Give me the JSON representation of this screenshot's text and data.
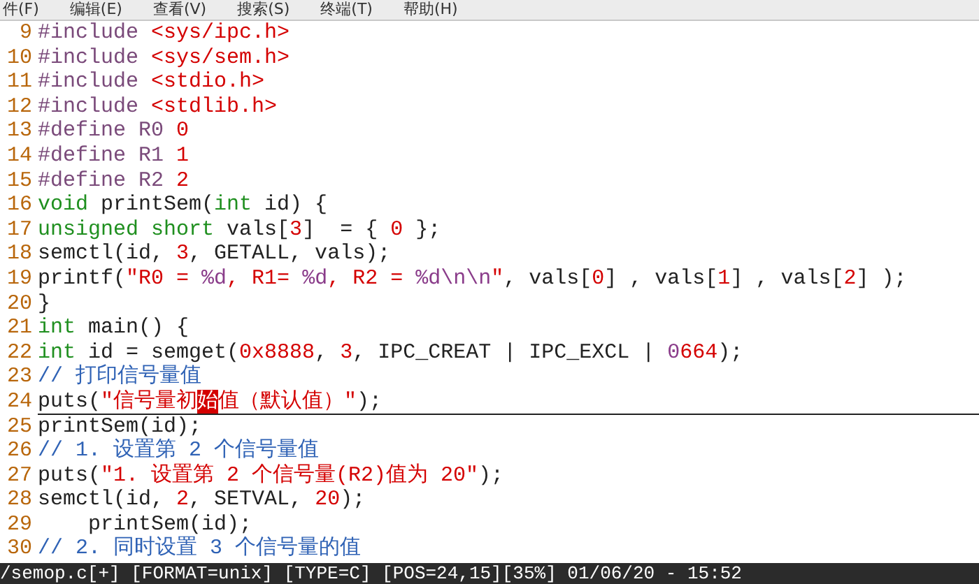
{
  "menu_bar": [
    "件(F)",
    "编辑(E)",
    "查看(V)",
    "搜索(S)",
    "终端(T)",
    "帮助(H)"
  ],
  "lines": [
    {
      "number": "9",
      "current": false,
      "segments": [
        {
          "text": "#include ",
          "kind": "preproc"
        },
        {
          "text": "<sys/ipc.h>",
          "kind": "string"
        }
      ]
    },
    {
      "number": "10",
      "current": false,
      "segments": [
        {
          "text": "#include ",
          "kind": "preproc"
        },
        {
          "text": "<sys/sem.h>",
          "kind": "string"
        }
      ]
    },
    {
      "number": "11",
      "current": false,
      "segments": [
        {
          "text": "#include ",
          "kind": "preproc"
        },
        {
          "text": "<stdio.h>",
          "kind": "string"
        }
      ]
    },
    {
      "number": "12",
      "current": false,
      "segments": [
        {
          "text": "#include ",
          "kind": "preproc"
        },
        {
          "text": "<stdlib.h>",
          "kind": "string"
        }
      ]
    },
    {
      "number": "13",
      "current": false,
      "segments": [
        {
          "text": "#define R0 ",
          "kind": "preproc"
        },
        {
          "text": "0",
          "kind": "number"
        }
      ]
    },
    {
      "number": "14",
      "current": false,
      "segments": [
        {
          "text": "#define R1 ",
          "kind": "preproc"
        },
        {
          "text": "1",
          "kind": "number"
        }
      ]
    },
    {
      "number": "15",
      "current": false,
      "segments": [
        {
          "text": "#define R2 ",
          "kind": "preproc"
        },
        {
          "text": "2",
          "kind": "number"
        }
      ]
    },
    {
      "number": "16",
      "current": false,
      "segments": [
        {
          "text": "void",
          "kind": "type"
        },
        {
          "text": " printSem(",
          "kind": "plain"
        },
        {
          "text": "int",
          "kind": "type"
        },
        {
          "text": " id) {",
          "kind": "plain"
        }
      ]
    },
    {
      "number": "17",
      "current": false,
      "segments": [
        {
          "text": "unsigned short",
          "kind": "type"
        },
        {
          "text": " vals[",
          "kind": "plain"
        },
        {
          "text": "3",
          "kind": "number"
        },
        {
          "text": "]  = { ",
          "kind": "plain"
        },
        {
          "text": "0",
          "kind": "number"
        },
        {
          "text": " };",
          "kind": "plain"
        }
      ]
    },
    {
      "number": "18",
      "current": false,
      "segments": [
        {
          "text": "semctl(id, ",
          "kind": "plain"
        },
        {
          "text": "3",
          "kind": "number"
        },
        {
          "text": ", GETALL, vals);",
          "kind": "plain"
        }
      ]
    },
    {
      "number": "19",
      "current": false,
      "segments": [
        {
          "text": "printf(",
          "kind": "plain"
        },
        {
          "text": "\"R0 = ",
          "kind": "string"
        },
        {
          "text": "%d",
          "kind": "special"
        },
        {
          "text": ", R1= ",
          "kind": "string"
        },
        {
          "text": "%d",
          "kind": "special"
        },
        {
          "text": ", R2 = ",
          "kind": "string"
        },
        {
          "text": "%d\\n\\n",
          "kind": "special"
        },
        {
          "text": "\"",
          "kind": "string"
        },
        {
          "text": ", vals[",
          "kind": "plain"
        },
        {
          "text": "0",
          "kind": "number"
        },
        {
          "text": "] , vals[",
          "kind": "plain"
        },
        {
          "text": "1",
          "kind": "number"
        },
        {
          "text": "] , vals[",
          "kind": "plain"
        },
        {
          "text": "2",
          "kind": "number"
        },
        {
          "text": "] );",
          "kind": "plain"
        }
      ]
    },
    {
      "number": "20",
      "current": false,
      "segments": [
        {
          "text": "}",
          "kind": "plain"
        }
      ]
    },
    {
      "number": "21",
      "current": false,
      "segments": [
        {
          "text": "int",
          "kind": "type"
        },
        {
          "text": " main() {",
          "kind": "plain"
        }
      ]
    },
    {
      "number": "22",
      "current": false,
      "segments": [
        {
          "text": "int",
          "kind": "type"
        },
        {
          "text": " id = semget(",
          "kind": "plain"
        },
        {
          "text": "0x8888",
          "kind": "number"
        },
        {
          "text": ", ",
          "kind": "plain"
        },
        {
          "text": "3",
          "kind": "number"
        },
        {
          "text": ", IPC_CREAT | IPC_EXCL | ",
          "kind": "plain"
        },
        {
          "text": "0",
          "kind": "special"
        },
        {
          "text": "664",
          "kind": "number"
        },
        {
          "text": ");",
          "kind": "plain"
        }
      ]
    },
    {
      "number": "23",
      "current": false,
      "segments": [
        {
          "text": "// 打印信号量值",
          "kind": "comment"
        }
      ]
    },
    {
      "number": "24",
      "current": true,
      "segments": [
        {
          "text": "puts(",
          "kind": "plain"
        },
        {
          "text": "\"信号量初",
          "kind": "string"
        },
        {
          "text": "始",
          "kind": "cursor"
        },
        {
          "text": "值（默认值）\"",
          "kind": "string"
        },
        {
          "text": ");",
          "kind": "plain"
        }
      ]
    },
    {
      "number": "25",
      "current": false,
      "segments": [
        {
          "text": "printSem(id);",
          "kind": "plain"
        }
      ]
    },
    {
      "number": "26",
      "current": false,
      "segments": [
        {
          "text": "// 1. 设置第 2 个信号量值",
          "kind": "comment"
        }
      ]
    },
    {
      "number": "27",
      "current": false,
      "segments": [
        {
          "text": "puts(",
          "kind": "plain"
        },
        {
          "text": "\"1. 设置第 2 个信号量(R2)值为 20\"",
          "kind": "string"
        },
        {
          "text": ");",
          "kind": "plain"
        }
      ]
    },
    {
      "number": "28",
      "current": false,
      "segments": [
        {
          "text": "semctl(id, ",
          "kind": "plain"
        },
        {
          "text": "2",
          "kind": "number"
        },
        {
          "text": ", SETVAL, ",
          "kind": "plain"
        },
        {
          "text": "20",
          "kind": "number"
        },
        {
          "text": ");",
          "kind": "plain"
        }
      ]
    },
    {
      "number": "29",
      "current": false,
      "segments": [
        {
          "text": "    printSem(id);",
          "kind": "plain"
        }
      ]
    },
    {
      "number": "30",
      "current": false,
      "segments": [
        {
          "text": "// 2. 同时设置 3 个信号量的值",
          "kind": "comment"
        }
      ]
    }
  ],
  "status_bar": "/semop.c[+] [FORMAT=unix] [TYPE=C] [POS=24,15][35%] 01/06/20 - 15:52"
}
